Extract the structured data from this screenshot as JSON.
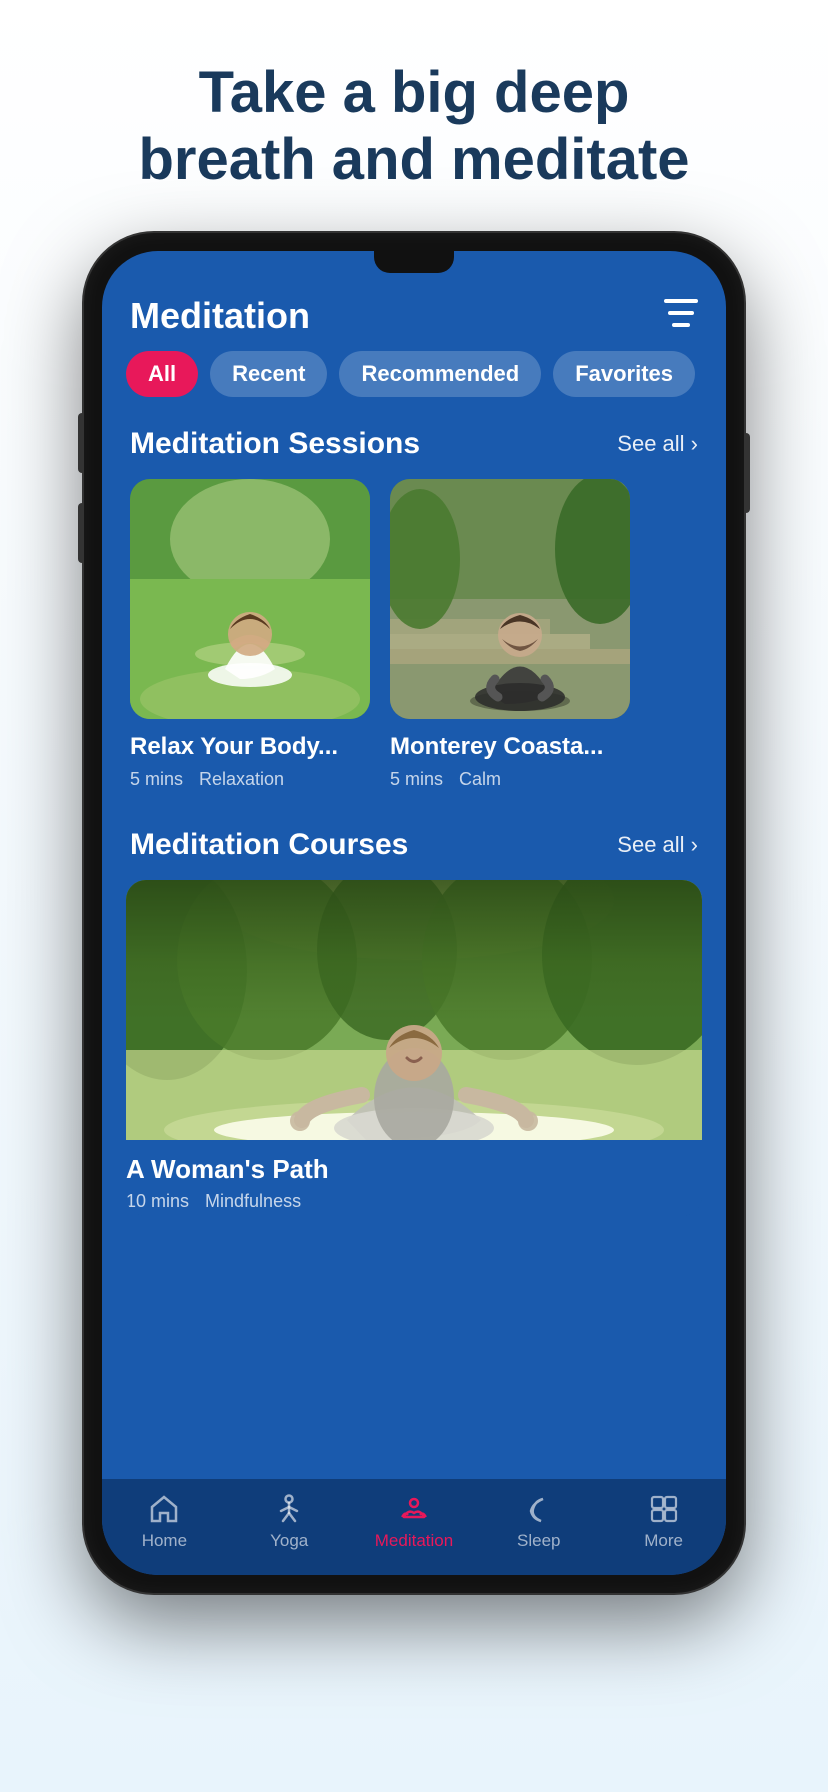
{
  "headline": {
    "line1": "Take a big deep",
    "line2": "breath and meditate"
  },
  "app": {
    "title": "Meditation",
    "filter_icon": "≡"
  },
  "filters": [
    {
      "label": "All",
      "active": true
    },
    {
      "label": "Recent",
      "active": false
    },
    {
      "label": "Recommended",
      "active": false
    },
    {
      "label": "Favorites",
      "active": false
    }
  ],
  "sessions_section": {
    "title": "Meditation Sessions",
    "see_all": "See all ›"
  },
  "sessions": [
    {
      "name": "Relax Your Body...",
      "duration": "5 mins",
      "tag": "Relaxation"
    },
    {
      "name": "Monterey Coasta...",
      "duration": "5 mins",
      "tag": "Calm"
    }
  ],
  "courses_section": {
    "title": "Meditation Courses",
    "see_all": "See all ›"
  },
  "courses": [
    {
      "name": "A Woman's Path",
      "duration": "10 mins",
      "tag": "Mindfulness"
    }
  ],
  "nav": [
    {
      "label": "Home",
      "icon": "home",
      "active": false
    },
    {
      "label": "Yoga",
      "icon": "yoga",
      "active": false
    },
    {
      "label": "Meditation",
      "icon": "meditation",
      "active": true
    },
    {
      "label": "Sleep",
      "icon": "sleep",
      "active": false
    },
    {
      "label": "More",
      "icon": "more",
      "active": false
    }
  ]
}
